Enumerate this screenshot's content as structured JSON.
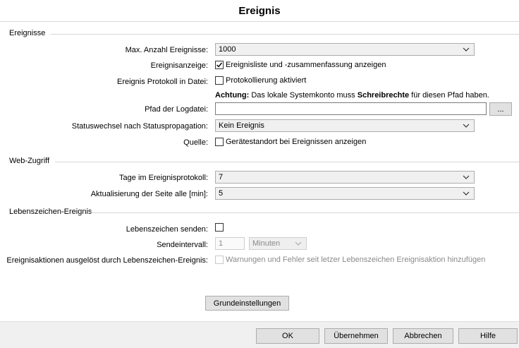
{
  "title": "Ereignis",
  "sections": {
    "events": "Ereignisse",
    "web": "Web-Zugriff",
    "heartbeat": "Lebenszeichen-Ereignis"
  },
  "events": {
    "max_label": "Max. Anzahl Ereignisse:",
    "max_value": "1000",
    "display_label": "Ereignisanzeige:",
    "display_checkbox": "Ereignisliste und -zusammenfassung anzeigen",
    "display_checked": true,
    "log_label": "Ereignis Protokoll in Datei:",
    "log_checkbox": "Protokollierung aktiviert",
    "log_checked": false,
    "warning_bold": "Achtung:",
    "warning_text1": "Das lokale Systemkonto muss",
    "warning_bold2": "Schreibrechte",
    "warning_text2": "für diesen Pfad haben.",
    "path_label": "Pfad der Logdatei:",
    "path_value": "",
    "browse_label": "...",
    "status_label": "Statuswechsel nach Statuspropagation:",
    "status_value": "Kein Ereignis",
    "source_label": "Quelle:",
    "source_checkbox": "Gerätestandort bei Ereignissen anzeigen",
    "source_checked": false
  },
  "web": {
    "days_label": "Tage im Ereignisprotokoll:",
    "days_value": "7",
    "refresh_label": "Aktualisierung der Seite alle [min]:",
    "refresh_value": "5"
  },
  "heartbeat": {
    "send_label": "Lebenszeichen senden:",
    "send_checked": false,
    "interval_label": "Sendeintervall:",
    "interval_value": "1",
    "interval_unit": "Minuten",
    "actions_label": "Ereignisaktionen ausgelöst durch Lebenszeichen-Ereignis:",
    "actions_checkbox": "Warnungen und Fehler seit letzer Lebenszeichen Ereignisaktion hinzufügen",
    "actions_checked": false
  },
  "defaults_button": "Grundeinstellungen",
  "footer": {
    "ok": "OK",
    "apply": "Übernehmen",
    "cancel": "Abbrechen",
    "help": "Hilfe"
  },
  "icons": {
    "chevron": "chevron-down-icon",
    "check": "checkmark-icon"
  }
}
